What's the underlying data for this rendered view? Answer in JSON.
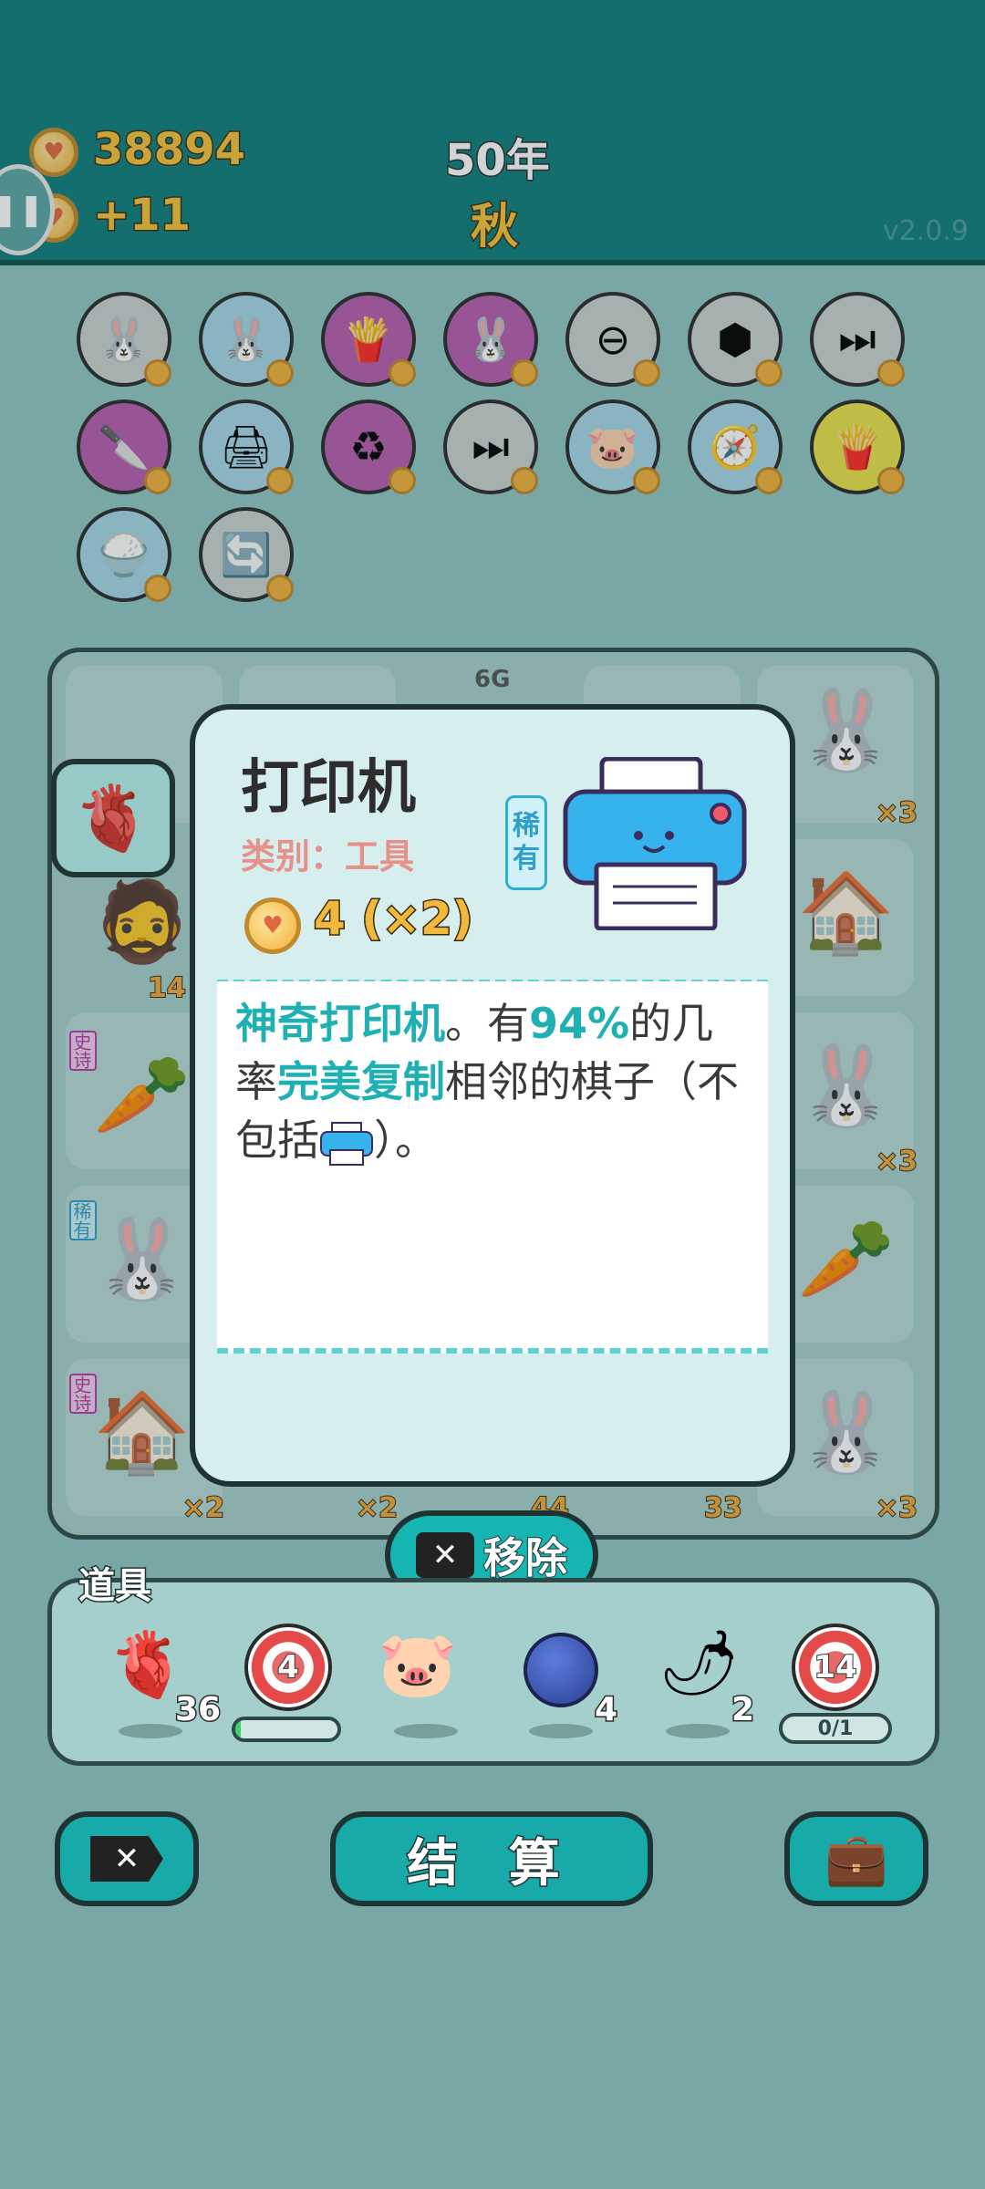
{
  "header": {
    "coins": "38894",
    "income": "+11",
    "year": "50年",
    "season": "秋",
    "version": "v2.0.9"
  },
  "relics": [
    {
      "icon": "rabbit-icon",
      "bg": "#c9d2d0"
    },
    {
      "icon": "rabbit-icon",
      "bg": "#a7d7ea"
    },
    {
      "icon": "fries-icon",
      "bg": "#b65db0"
    },
    {
      "icon": "rabbit-icon",
      "bg": "#b65db0"
    },
    {
      "icon": "minus-circle-icon",
      "bg": "#c9d2d0"
    },
    {
      "icon": "cubes-icon",
      "bg": "#c9d2d0"
    },
    {
      "icon": "skip-icon",
      "bg": "#c9d2d0"
    },
    {
      "icon": "cleaver-icon",
      "bg": "#b65db0"
    },
    {
      "icon": "printer-icon",
      "bg": "#a7d7ea"
    },
    {
      "icon": "recycle-icon",
      "bg": "#b65db0"
    },
    {
      "icon": "skip-icon",
      "bg": "#c9d2d0"
    },
    {
      "icon": "piggy-bank-icon",
      "bg": "#a7d7ea"
    },
    {
      "icon": "compass-icon",
      "bg": "#a7d7ea"
    },
    {
      "icon": "fries-icon",
      "bg": "#e9e24a"
    },
    {
      "icon": "rice-bowl-icon",
      "bg": "#a7d7ea"
    },
    {
      "icon": "refresh-icon",
      "bg": "#c9d2d0"
    }
  ],
  "board": {
    "top_label": "6G",
    "tags": [
      "史诗",
      "史诗",
      "稀有",
      "史诗",
      "稀有"
    ],
    "counts": [
      "×3",
      "×3",
      "14",
      "×3",
      "×2",
      "×2",
      "44",
      "33",
      "×3"
    ]
  },
  "modal": {
    "title": "打印机",
    "category": "类别：工具",
    "cost": "4 (×2)",
    "rarity": [
      "稀",
      "有"
    ],
    "desc_1": "神奇打印机",
    "desc_2": "。有",
    "desc_3": "94%",
    "desc_4": "的几率",
    "desc_5": "完美复制",
    "desc_6": "相邻的棋子（不包括",
    "desc_7": "）。"
  },
  "remove_button": {
    "label": "移除"
  },
  "items": {
    "title": "道具",
    "list": [
      {
        "icon": "liver-icon",
        "count": "36"
      },
      {
        "icon": "target-icon",
        "value": "4",
        "progress": 0.05
      },
      {
        "icon": "piggy-bank-icon",
        "count": ""
      },
      {
        "icon": "blueberry-icon",
        "count": "4"
      },
      {
        "icon": "pepper-icon",
        "count": "2"
      },
      {
        "icon": "target-icon",
        "value": "14",
        "progress_text": "0/1"
      }
    ]
  },
  "bottom": {
    "settle_label": "结 算"
  }
}
